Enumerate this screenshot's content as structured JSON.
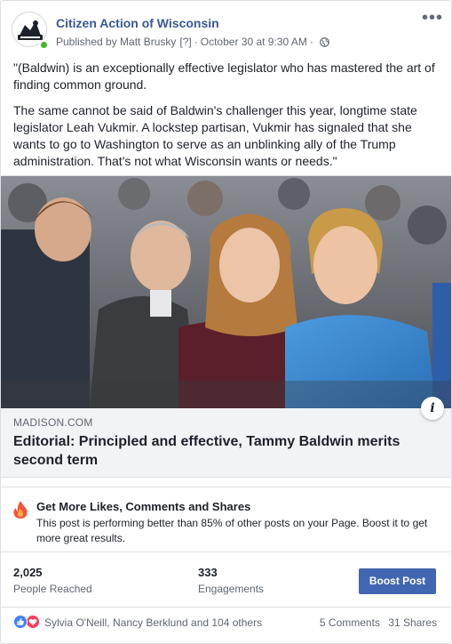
{
  "post": {
    "page_name": "Citizen Action of Wisconsin",
    "published_by": "Published by Matt Brusky",
    "help_marker": "[?]",
    "separator": "·",
    "timestamp": "October 30 at 9:30 AM",
    "separator2": "·",
    "more_icon_glyph": "•••",
    "paragraphs": [
      "\"(Baldwin) is an exceptionally effective legislator who has mastered the art of finding common ground.",
      "The same cannot be said of Baldwin's challenger this year, longtime state legislator Leah Vukmir. A lockstep partisan, Vukmir has signaled that she wants to go to Washington to serve as an unblinking ally of the Trump administration. That's not what Wisconsin wants or needs.\""
    ]
  },
  "link_preview": {
    "domain": "MADISON.COM",
    "headline": "Editorial: Principled and effective, Tammy Baldwin merits second term",
    "info_glyph": "i"
  },
  "boost_tip": {
    "title": "Get More Likes, Comments and Shares",
    "body": "This post is performing better than 85% of other posts on your Page. Boost it to get more great results."
  },
  "insights": {
    "reached_value": "2,025",
    "reached_label": "People Reached",
    "engagements_value": "333",
    "engagements_label": "Engagements",
    "boost_button": "Boost Post"
  },
  "footer": {
    "reactors": "Sylvia O'Neill, Nancy Berklund and 104 others",
    "comments": "5 Comments",
    "shares": "31 Shares"
  },
  "colors": {
    "link_blue": "#385898",
    "button_blue": "#4267b2",
    "like_blue": "#4080ff",
    "love_red": "#f33e58",
    "online_green": "#42b72a",
    "fire_orange": "#f5533d"
  },
  "icons": [
    "page-avatar-logo",
    "globe-icon",
    "more-options-icon",
    "info-icon",
    "fire-icon",
    "like-reaction-icon",
    "love-reaction-icon"
  ]
}
